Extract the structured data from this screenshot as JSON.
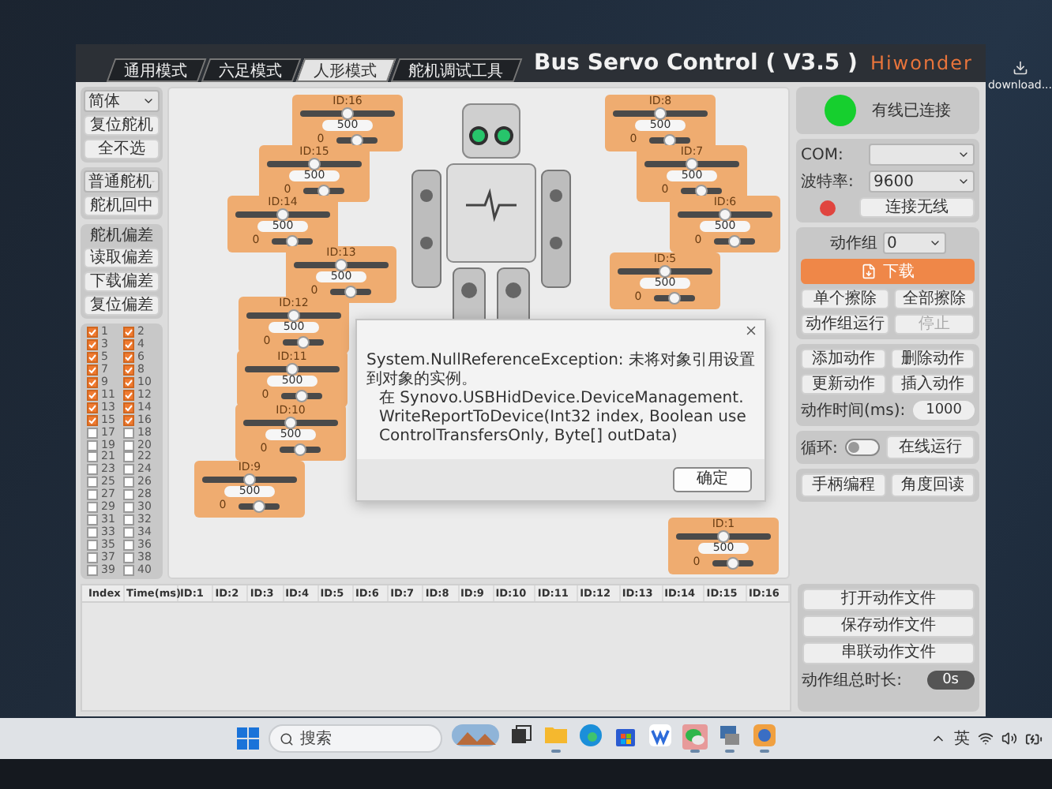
{
  "window": {
    "title": "Bus Servo Control ( V3.5 )",
    "logo": "Hiwonder"
  },
  "tabs": [
    {
      "label": "通用模式",
      "selected": false
    },
    {
      "label": "六足模式",
      "selected": false
    },
    {
      "label": "人形模式",
      "selected": true
    },
    {
      "label": "舵机调试工具",
      "selected": false
    }
  ],
  "left_panel": {
    "language": "简体",
    "buttons_top": [
      "复位舵机",
      "全不选"
    ],
    "servo_type": "普通舵机",
    "center_button": "舵机回中",
    "offset_title": "舵机偏差",
    "offset_buttons": [
      "读取偏差",
      "下载偏差",
      "复位偏差"
    ],
    "servo_checks": [
      {
        "label": "1",
        "checked": true
      },
      {
        "label": "2",
        "checked": true
      },
      {
        "label": "3",
        "checked": true
      },
      {
        "label": "4",
        "checked": true
      },
      {
        "label": "5",
        "checked": true
      },
      {
        "label": "6",
        "checked": true
      },
      {
        "label": "7",
        "checked": true
      },
      {
        "label": "8",
        "checked": true
      },
      {
        "label": "9",
        "checked": true
      },
      {
        "label": "10",
        "checked": true
      },
      {
        "label": "11",
        "checked": true
      },
      {
        "label": "12",
        "checked": true
      },
      {
        "label": "13",
        "checked": true
      },
      {
        "label": "14",
        "checked": true
      },
      {
        "label": "15",
        "checked": true
      },
      {
        "label": "16",
        "checked": true
      },
      {
        "label": "17",
        "checked": false
      },
      {
        "label": "18",
        "checked": false
      },
      {
        "label": "19",
        "checked": false
      },
      {
        "label": "20",
        "checked": false
      },
      {
        "label": "21",
        "checked": false
      },
      {
        "label": "22",
        "checked": false
      },
      {
        "label": "23",
        "checked": false
      },
      {
        "label": "24",
        "checked": false
      },
      {
        "label": "25",
        "checked": false
      },
      {
        "label": "26",
        "checked": false
      },
      {
        "label": "27",
        "checked": false
      },
      {
        "label": "28",
        "checked": false
      },
      {
        "label": "29",
        "checked": false
      },
      {
        "label": "30",
        "checked": false
      },
      {
        "label": "31",
        "checked": false
      },
      {
        "label": "32",
        "checked": false
      },
      {
        "label": "33",
        "checked": false
      },
      {
        "label": "34",
        "checked": false
      },
      {
        "label": "35",
        "checked": false
      },
      {
        "label": "36",
        "checked": false
      },
      {
        "label": "37",
        "checked": false
      },
      {
        "label": "38",
        "checked": false
      },
      {
        "label": "39",
        "checked": false
      },
      {
        "label": "40",
        "checked": false
      }
    ]
  },
  "servos": [
    {
      "label": "ID:16",
      "level": 0.5,
      "value": "500",
      "offset": {
        "label": "0",
        "level": 0.5
      }
    },
    {
      "label": "ID:15",
      "level": 0.5,
      "value": "500",
      "offset": {
        "label": "0",
        "level": 0.5
      }
    },
    {
      "label": "ID:14",
      "level": 0.5,
      "value": "500",
      "offset": {
        "label": "0",
        "level": 0.5
      }
    },
    {
      "label": "ID:13",
      "level": 0.5,
      "value": "500",
      "offset": {
        "label": "0",
        "level": 0.5
      }
    },
    {
      "label": "ID:12",
      "level": 0.5,
      "value": "500",
      "offset": {
        "label": "0",
        "level": 0.5
      }
    },
    {
      "label": "ID:11",
      "level": 0.5,
      "value": "500",
      "offset": {
        "label": "0",
        "level": 0.5
      }
    },
    {
      "label": "ID:10",
      "level": 0.5,
      "value": "500",
      "offset": {
        "label": "0",
        "level": 0.5
      }
    },
    {
      "label": "ID:9",
      "level": 0.5,
      "value": "500",
      "offset": {
        "label": "0",
        "level": 0.5
      }
    },
    {
      "label": "ID:8",
      "level": 0.5,
      "value": "500",
      "offset": {
        "label": "0",
        "level": 0.5
      }
    },
    {
      "label": "ID:7",
      "level": 0.5,
      "value": "500",
      "offset": {
        "label": "0",
        "level": 0.5
      }
    },
    {
      "label": "ID:6",
      "level": 0.5,
      "value": "500",
      "offset": {
        "label": "0",
        "level": 0.5
      }
    },
    {
      "label": "ID:5",
      "level": 0.5,
      "value": "500",
      "offset": {
        "label": "0",
        "level": 0.5
      }
    },
    {
      "label": "ID:1",
      "level": 0.5,
      "value": "500",
      "offset": {
        "label": "0",
        "level": 0.5
      }
    }
  ],
  "dialog": {
    "message": [
      "System.NullReferenceException: 未将对象引用设置到对象的实例。",
      "在 Synovo.USBHidDevice.DeviceManagement.WriteReportToDevice(Int32 index, Boolean useControlTransfersOnly, Byte[] outData)"
    ],
    "button": "确定"
  },
  "right_panel": {
    "connection": {
      "status": "有线已连接",
      "connected": true
    },
    "com_label": "COM:",
    "baud": {
      "label": "波特率:",
      "value": "9600"
    },
    "wireless": {
      "connected": false,
      "button": "连接无线"
    },
    "action_group": {
      "label": "动作组",
      "value": "0"
    },
    "download": "下载",
    "group_buttons": [
      {
        "label": "单个擦除",
        "disabled": false
      },
      {
        "label": "全部擦除",
        "disabled": false
      },
      {
        "label": "动作组运行",
        "disabled": false
      },
      {
        "label": "停止",
        "disabled": true
      }
    ],
    "action_buttons": [
      {
        "label": "添加动作",
        "disabled": false
      },
      {
        "label": "删除动作",
        "disabled": false
      },
      {
        "label": "更新动作",
        "disabled": false
      },
      {
        "label": "插入动作",
        "disabled": false
      }
    ],
    "action_time": {
      "label": "动作时间(ms):",
      "value": "1000"
    },
    "loop": {
      "label": "循环:",
      "on": false
    },
    "run_online": "在线运行",
    "bottom_buttons": [
      "手柄编程",
      "角度回读"
    ],
    "file_buttons": [
      "打开动作文件",
      "保存动作文件",
      "串联动作文件"
    ],
    "total_time": {
      "label": "动作组总时长:",
      "value": "0s"
    }
  },
  "table": {
    "columns": [
      "Index",
      "Time(ms)",
      "ID:1",
      "ID:2",
      "ID:3",
      "ID:4",
      "ID:5",
      "ID:6",
      "ID:7",
      "ID:8",
      "ID:9",
      "ID:10",
      "ID:11",
      "ID:12",
      "ID:13",
      "ID:14",
      "ID:15",
      "ID:16"
    ]
  },
  "desktop": {
    "icon_label": "download..."
  },
  "taskbar": {
    "search": "搜索",
    "ime": "英",
    "apps": [
      {
        "kind": "widget",
        "running": false
      },
      {
        "kind": "taskview",
        "running": false
      },
      {
        "kind": "explorer",
        "running": true
      },
      {
        "kind": "edge",
        "running": false
      },
      {
        "kind": "store",
        "running": false
      },
      {
        "kind": "wps",
        "running": false
      },
      {
        "kind": "wechat",
        "running": true
      },
      {
        "kind": "tool",
        "running": true
      },
      {
        "kind": "robot",
        "running": true
      }
    ]
  }
}
